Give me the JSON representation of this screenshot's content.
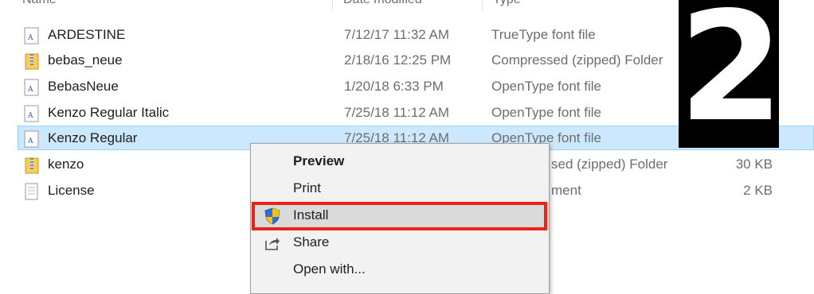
{
  "header": {
    "name_col": "Name",
    "date_col": "Date modified",
    "type_col": "Type"
  },
  "files": [
    {
      "name": "ARDESTINE",
      "date": "7/12/17 11:32 AM",
      "type": "TrueType font file",
      "size": "",
      "icon": "font-file-icon"
    },
    {
      "name": "bebas_neue",
      "date": "2/18/16 12:25 PM",
      "type": "Compressed (zipped) Folder",
      "size": "",
      "icon": "zip-folder-icon"
    },
    {
      "name": "BebasNeue",
      "date": "1/20/18 6:33 PM",
      "type": "OpenType font file",
      "size": "",
      "icon": "font-file-icon"
    },
    {
      "name": "Kenzo Regular Italic",
      "date": "7/25/18 11:12 AM",
      "type": "OpenType font file",
      "size": "",
      "icon": "font-file-icon"
    },
    {
      "name": "Kenzo Regular",
      "date": "7/25/18 11:12 AM",
      "type": "OpenType font file",
      "size": "",
      "icon": "font-file-icon",
      "selected": true
    },
    {
      "name": "kenzo",
      "date": "",
      "type": "sed (zipped) Folder",
      "size": "30 KB",
      "icon": "zip-folder-icon"
    },
    {
      "name": "License",
      "date": "",
      "type": "ment",
      "size": "2 KB",
      "icon": "text-document-icon"
    }
  ],
  "badge": "2",
  "context_menu": {
    "items": [
      {
        "label": "Preview",
        "bold": true,
        "icon": ""
      },
      {
        "label": "Print",
        "bold": false,
        "icon": ""
      },
      {
        "label": "Install",
        "bold": false,
        "icon": "uac-shield-icon",
        "highlighted": true
      },
      {
        "label": "Share",
        "bold": false,
        "icon": "share-icon"
      },
      {
        "label": "Open with...",
        "bold": false,
        "icon": ""
      }
    ]
  },
  "colors": {
    "selection": "#cce8ff",
    "highlight_box": "#e8231c",
    "badge_bg": "#000000"
  }
}
